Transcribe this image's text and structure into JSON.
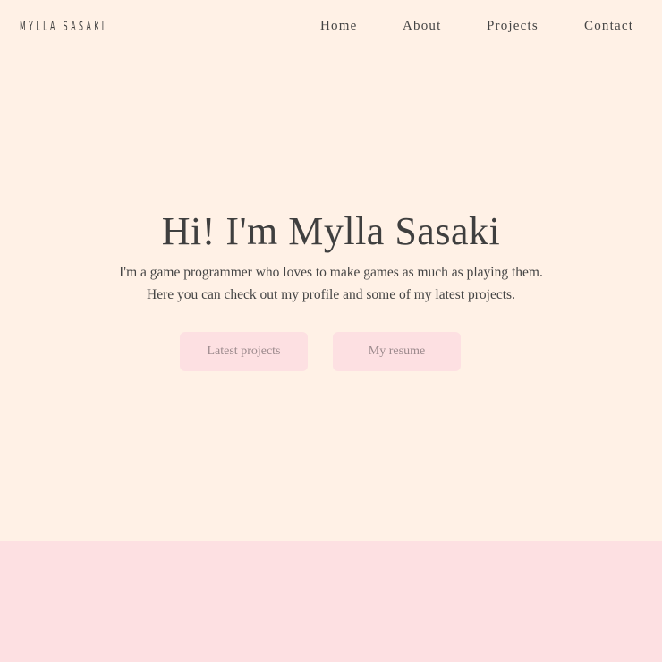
{
  "header": {
    "logo": "MYLLA SASAKI",
    "nav": [
      {
        "label": "Home"
      },
      {
        "label": "About"
      },
      {
        "label": "Projects"
      },
      {
        "label": "Contact"
      }
    ]
  },
  "hero": {
    "title": "Hi! I'm Mylla Sasaki",
    "line1": "I'm a game programmer who loves to make games as much as playing them.",
    "line2": "Here you can check out my profile and some of my latest projects.",
    "buttons": {
      "projects": "Latest projects",
      "resume": "My resume"
    }
  },
  "colors": {
    "background": "#fff1e6",
    "accent_pink": "#fde0e2",
    "text": "#444444",
    "button_text": "#9c8a8d"
  }
}
